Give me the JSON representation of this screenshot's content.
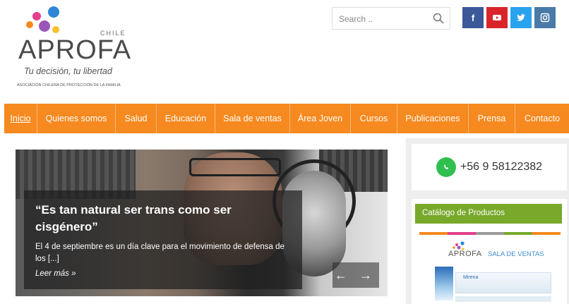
{
  "header": {
    "logo_word": "APROFA",
    "logo_country": "CHILE",
    "tagline": "Tu decisión, tu libertad",
    "org_full_name": "ASOCIACIÓN CHILENA DE PROTECCIÓN DE LA FAMILIA",
    "search_placeholder": "Search ..",
    "social": [
      {
        "name": "facebook",
        "label": "f",
        "color": "#3b5998"
      },
      {
        "name": "youtube",
        "label": "",
        "color": "#d9252a"
      },
      {
        "name": "twitter",
        "label": "",
        "color": "#2aa3ef"
      },
      {
        "name": "instagram",
        "label": "",
        "color": "#4a7aa7"
      }
    ]
  },
  "nav": {
    "items": [
      "Inicio",
      "Quienes somos",
      "Salud",
      "Educación",
      "Sala de ventas",
      "Área Joven",
      "Cursos",
      "Publicaciones",
      "Prensa",
      "Contacto"
    ],
    "active": "Inicio",
    "color": "#f6891f"
  },
  "slider": {
    "title": "“Es tan natural ser trans como ser cisgénero”",
    "excerpt": "El 4 de septiembre es un día clave para el movimiento de defensa de los [...]",
    "read_more": "Leer más »",
    "prev_icon": "arrow-left-icon",
    "next_icon": "arrow-right-icon"
  },
  "sidebar": {
    "phone": "+56 9 58122382",
    "catalog_title": "Catálogo de Productos",
    "catalog_color": "#78a92b",
    "stripe_colors": [
      "#f6891f",
      "#e23f8c",
      "#9b9b9b",
      "#78a92b",
      "#f6891f"
    ],
    "mini_logo_word": "APROFA",
    "mini_sales": "SALA DE VENTAS",
    "product_label": "Mirena"
  }
}
